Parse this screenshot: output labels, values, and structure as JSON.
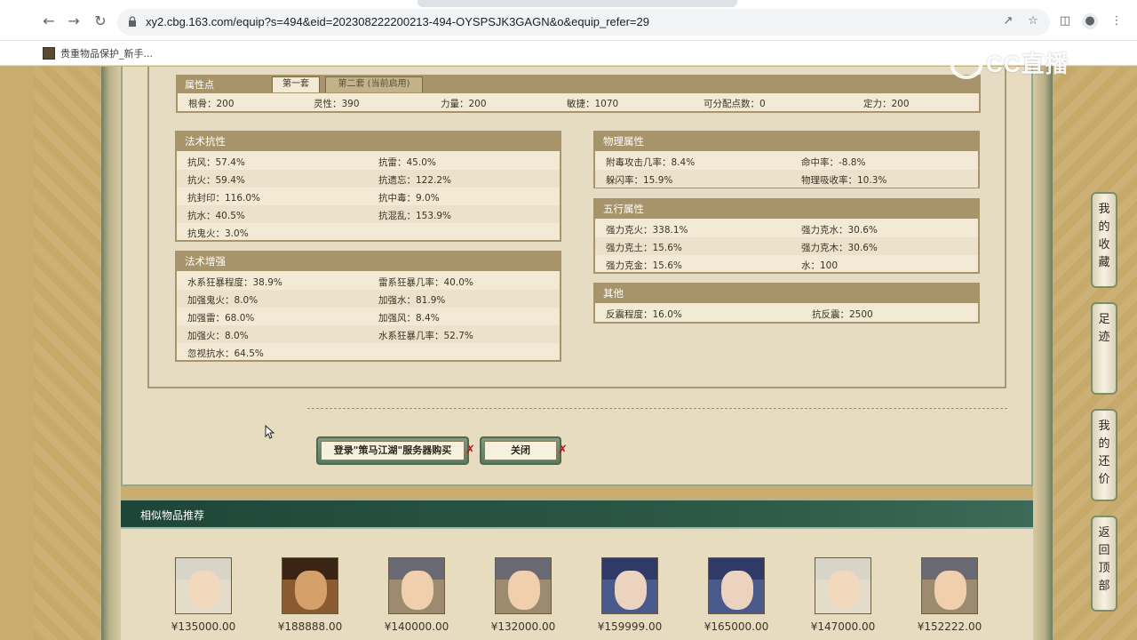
{
  "browser": {
    "url": "xy2.cbg.163.com/equip?s=494&eid=202308222200213-494-OYSPSJK3GAGN&o&equip_refer=29",
    "bookmark": "贵重物品保护_新手...",
    "watermark": "CC直播"
  },
  "attr_points": {
    "title": "属性点",
    "tabs": [
      "第一套",
      "第二套 (当前启用)"
    ],
    "items": [
      "根骨：200",
      "灵性：390",
      "力量：200",
      "敏捷：1070",
      "可分配点数：0",
      "定力：200"
    ]
  },
  "sections": {
    "magic_resist": {
      "title": "法术抗性",
      "rows": [
        [
          "抗风：57.4%",
          "抗雷：45.0%"
        ],
        [
          "抗火：59.4%",
          "抗遗忘：122.2%"
        ],
        [
          "抗封印：116.0%",
          "抗中毒：9.0%"
        ],
        [
          "抗水：40.5%",
          "抗混乱：153.9%"
        ],
        [
          "抗鬼火：3.0%",
          ""
        ]
      ]
    },
    "magic_enhance": {
      "title": "法术增强",
      "rows": [
        [
          "水系狂暴程度：38.9%",
          "雷系狂暴几率：40.0%"
        ],
        [
          "加强鬼火：8.0%",
          "加强水：81.9%"
        ],
        [
          "加强雷：68.0%",
          "加强风：8.4%"
        ],
        [
          "加强火：8.0%",
          "水系狂暴几率：52.7%"
        ],
        [
          "忽视抗水：64.5%",
          ""
        ]
      ]
    },
    "physical": {
      "title": "物理属性",
      "rows": [
        [
          "附毒攻击几率：8.4%",
          "命中率：-8.8%"
        ],
        [
          "躲闪率：15.9%",
          "物理吸收率：10.3%"
        ]
      ]
    },
    "five_elements": {
      "title": "五行属性",
      "rows": [
        [
          "强力克火：338.1%",
          "强力克水：30.6%"
        ],
        [
          "强力克土：15.6%",
          "强力克木：30.6%"
        ],
        [
          "强力克金：15.6%",
          "水：100"
        ]
      ]
    },
    "other": {
      "title": "其他",
      "rows": [
        [
          "反震程度：16.0%",
          "抗反震：2500"
        ]
      ]
    }
  },
  "buttons": {
    "login_buy": "登录\"策马江湖\"服务器购买",
    "close": "关闭"
  },
  "similar": {
    "title": "相似物品推荐",
    "items": [
      {
        "price": "¥135000.00",
        "hair": "#d8d4c8",
        "face": "#f1d9bd",
        "bg": "#e4dccb"
      },
      {
        "price": "¥188888.00",
        "hair": "#3a2416",
        "face": "#d6a06a",
        "bg": "#8a5a30"
      },
      {
        "price": "¥140000.00",
        "hair": "#6a6a74",
        "face": "#efcfae",
        "bg": "#9c8b6e"
      },
      {
        "price": "¥132000.00",
        "hair": "#6a6a74",
        "face": "#efcfae",
        "bg": "#9c8b6e"
      },
      {
        "price": "¥159999.00",
        "hair": "#2f3a66",
        "face": "#ecd3c0",
        "bg": "#4a5a8c"
      },
      {
        "price": "¥165000.00",
        "hair": "#2f3a66",
        "face": "#ecd3c0",
        "bg": "#4a5a8c"
      },
      {
        "price": "¥147000.00",
        "hair": "#d8d4c8",
        "face": "#f1d9bd",
        "bg": "#e4dccb"
      },
      {
        "price": "¥152222.00",
        "hair": "#6a6a74",
        "face": "#efcfae",
        "bg": "#9c8b6e"
      }
    ]
  },
  "float_menu": [
    {
      "label": "我的收藏",
      "chars": [
        "我",
        "的",
        "收",
        "藏"
      ]
    },
    {
      "label": "足迹",
      "chars": [
        "足",
        "迹"
      ]
    },
    {
      "label": "我的还价",
      "chars": [
        "我",
        "的",
        "还",
        "价"
      ]
    },
    {
      "label": "返回顶部",
      "chars": [
        "返",
        "回",
        "顶",
        "部"
      ]
    }
  ]
}
